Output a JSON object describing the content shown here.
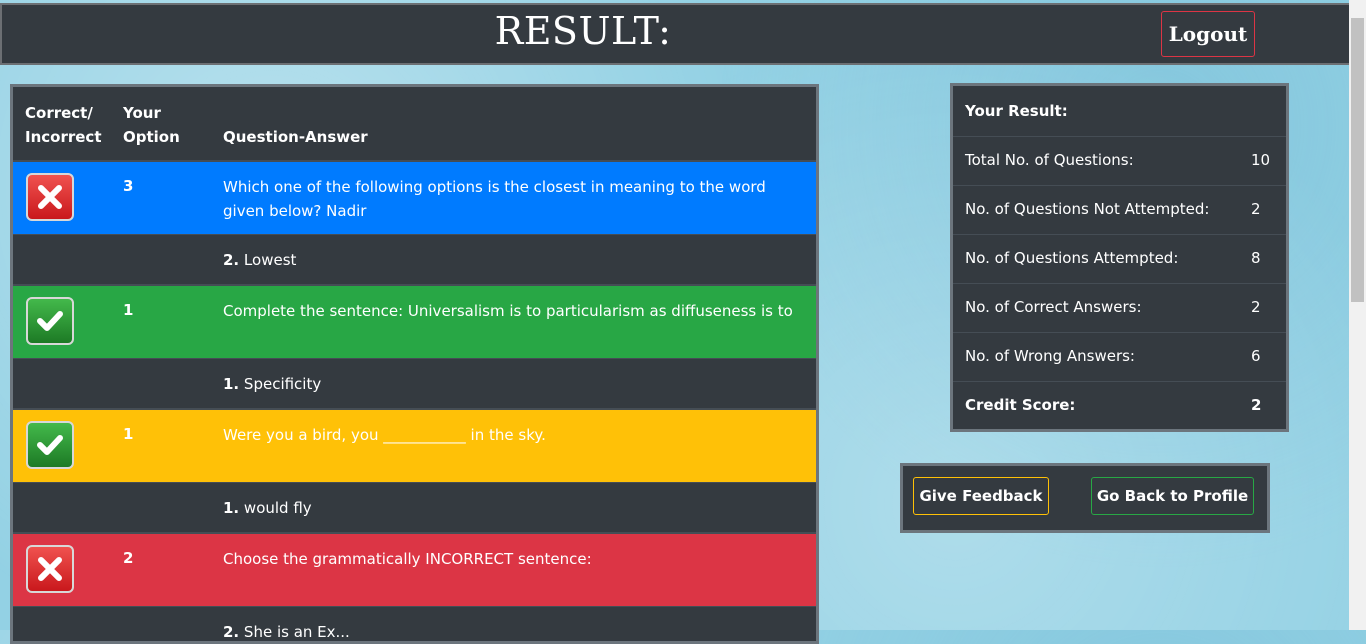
{
  "header": {
    "title": "RESULT:",
    "logout_label": "Logout"
  },
  "results_table": {
    "headers": {
      "status_line1": "Correct/",
      "status_line2": "Incorrect",
      "option_line1": "Your",
      "option_line2": "Option",
      "question_answer": "Question-Answer"
    },
    "rows": [
      {
        "status": "incorrect",
        "row_color": "#007bff",
        "your_option": "3",
        "question": "Which one of the following options is the closest in meaning to the word given below? Nadir",
        "answer_num": "2.",
        "answer_text": "Lowest"
      },
      {
        "status": "correct",
        "row_color": "#28a745",
        "your_option": "1",
        "question": "Complete the sentence: Universalism is to particularism as diffuseness is to",
        "answer_num": "1.",
        "answer_text": "Specificity"
      },
      {
        "status": "correct",
        "row_color": "#ffc107",
        "your_option": "1",
        "question": "Were you a bird, you ___________ in the sky.",
        "answer_num": "1.",
        "answer_text": "would fly"
      },
      {
        "status": "incorrect",
        "row_color": "#dc3545",
        "your_option": "2",
        "question": "Choose the grammatically INCORRECT sentence:",
        "answer_num": "2.",
        "answer_text": "She is an Ex..."
      }
    ]
  },
  "summary": {
    "heading": "Your Result:",
    "rows": [
      {
        "label": "Total No. of Questions:",
        "value": "10"
      },
      {
        "label": "No. of Questions Not Attempted:",
        "value": "2"
      },
      {
        "label": "No. of Questions Attempted:",
        "value": "8"
      },
      {
        "label": "No. of Correct Answers:",
        "value": "2"
      },
      {
        "label": "No. of Wrong Answers:",
        "value": "6"
      },
      {
        "label": "Credit Score:",
        "value": "2"
      }
    ]
  },
  "actions": {
    "feedback_label": "Give Feedback",
    "back_label": "Go Back to Profile"
  },
  "icons": {
    "correct": "check-icon",
    "incorrect": "cross-icon"
  }
}
